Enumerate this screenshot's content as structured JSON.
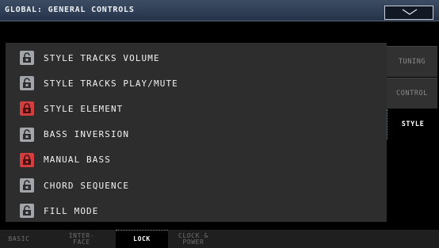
{
  "header": {
    "title": "GLOBAL: GENERAL CONTROLS",
    "menu_icon": "chevron-down-icon"
  },
  "locks": [
    {
      "label": "STYLE TRACKS VOLUME",
      "locked": false
    },
    {
      "label": "STYLE TRACKS PLAY/MUTE",
      "locked": false
    },
    {
      "label": "STYLE ELEMENT",
      "locked": true
    },
    {
      "label": "BASS INVERSION",
      "locked": false
    },
    {
      "label": "MANUAL BASS",
      "locked": true
    },
    {
      "label": "CHORD SEQUENCE",
      "locked": false
    },
    {
      "label": "FILL MODE",
      "locked": false
    }
  ],
  "side_tabs": [
    {
      "label": "TUNING",
      "active": false
    },
    {
      "label": "CONTROL",
      "active": false
    },
    {
      "label": "STYLE",
      "active": true
    }
  ],
  "bottom_tabs": [
    {
      "label": "BASIC",
      "active": false
    },
    {
      "label": "INTER-\nFACE",
      "active": false
    },
    {
      "label": "LOCK",
      "active": true
    },
    {
      "label": "CLOCK &\nPOWER",
      "active": false
    }
  ],
  "colors": {
    "lock_on": "#d23d3d",
    "lock_off": "#a2a6ab",
    "title_bar": "#2f3d54"
  }
}
